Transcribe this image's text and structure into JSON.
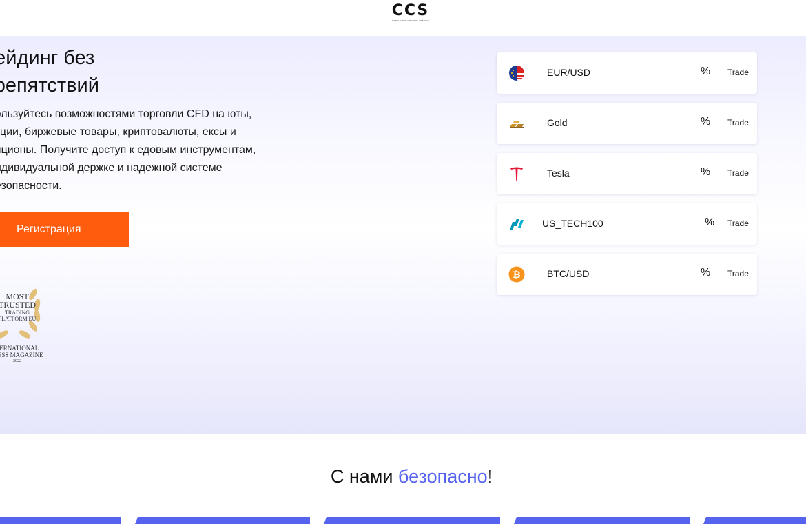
{
  "header": {
    "logo_text": "CCS",
    "logo_subtext": "CONSULTING CONTROL SESSION"
  },
  "hero": {
    "title": "рейдинг без препятствий",
    "description": "пользуйтесь возможностями торговли CFD на юты, акции, биржевые товары, криптовалюты, ексы и опционы. Получите доступ к едовым инструментам, индивидуальной держке и надежной системе безопасности.",
    "cta_label": "Регистрация",
    "award": {
      "line1": "MOST",
      "line2": "TRUSTED",
      "line3": "TRADING",
      "line4": "PLATFORM EU",
      "line5": "TERNATIONAL",
      "line6": "INESS MAGAZINE",
      "line7": "2022"
    }
  },
  "instruments": [
    {
      "name": "EUR/USD",
      "percent": "%",
      "action": "Trade",
      "icon": "eu-us-flag-icon"
    },
    {
      "name": "Gold",
      "percent": "%",
      "action": "Trade",
      "icon": "gold-bars-icon"
    },
    {
      "name": "Tesla",
      "percent": "%",
      "action": "Trade",
      "icon": "tesla-logo-icon"
    },
    {
      "name": "US_TECH100",
      "percent": "%",
      "action": "Trade",
      "icon": "nasdaq-logo-icon"
    },
    {
      "name": "BTC/USD",
      "percent": "%",
      "action": "Trade",
      "icon": "bitcoin-icon"
    }
  ],
  "safety": {
    "title_plain": "С нами ",
    "title_accent": "безопасно",
    "title_end": "!"
  },
  "colors": {
    "accent_orange": "#ff5c0d",
    "accent_blue": "#5563f0",
    "tesla_red": "#e31937",
    "bitcoin_orange": "#f7931a"
  }
}
